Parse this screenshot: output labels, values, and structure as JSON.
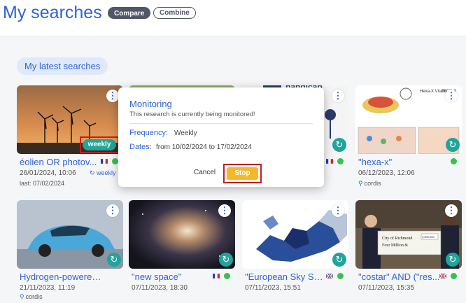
{
  "header": {
    "title": "My searches",
    "compare_label": "Compare",
    "combine_label": "Combine"
  },
  "section": {
    "label": "My latest searches"
  },
  "cards": [
    {
      "title": "éolien OR photov...",
      "date": "26/01/2024, 10:06",
      "meta": "last: 07/02/2024",
      "side_meta": "weekly",
      "flag": "fr"
    },
    {
      "title": "",
      "date": "",
      "meta": "",
      "side_meta": "",
      "flag": ""
    },
    {
      "title": "",
      "date": "",
      "meta": "",
      "side_meta": "",
      "flag": "fr"
    },
    {
      "title": "\"hexa-x\"",
      "date": "06/12/2023, 12:06",
      "meta": "cordis",
      "side_meta": "",
      "flag": ""
    },
    {
      "title": "Hydrogen-powered ...",
      "date": "21/11/2023, 11:19",
      "meta": "cordis",
      "side_meta": "",
      "flag": ""
    },
    {
      "title": "\"new space\"",
      "date": "07/11/2023, 18:30",
      "meta": "",
      "side_meta": "",
      "flag": "fr"
    },
    {
      "title": "\"European Sky Shi...",
      "date": "07/11/2023, 15:51",
      "meta": "",
      "side_meta": "",
      "flag": "gb"
    },
    {
      "title": "\"costar\" AND (\"res...",
      "date": "07/11/2023, 15:35",
      "meta": "",
      "side_meta": "",
      "flag": "gb"
    }
  ],
  "badge": {
    "weekly_label": "weekly"
  },
  "modal": {
    "title": "Monitoring",
    "message": "This research is currently being monitored!",
    "frequency_label": "Frequency:",
    "frequency_value": "Weekly",
    "dates_label": "Dates:",
    "dates_value": "from 10/02/2024 to 17/02/2024",
    "cancel_label": "Cancel",
    "stop_label": "Stop"
  },
  "thumb_text": {
    "handicap": "handicap",
    "hexa_name": "Hexa-X Vision",
    "jrc": "JRC2LS",
    "city": "City of Richmond",
    "amount": "Four Million &",
    "cheque_sum": "4,000,000"
  },
  "colors": {
    "accent": "#2f63d6",
    "teal": "#1fa59b",
    "status_green": "#36c24a",
    "stop_yellow": "#f7b728",
    "highlight_red": "#c21e1e"
  },
  "icons": {
    "kebab": "more-vert-icon",
    "refresh": "refresh-icon",
    "search": "search-icon",
    "sync": "sync-icon"
  }
}
